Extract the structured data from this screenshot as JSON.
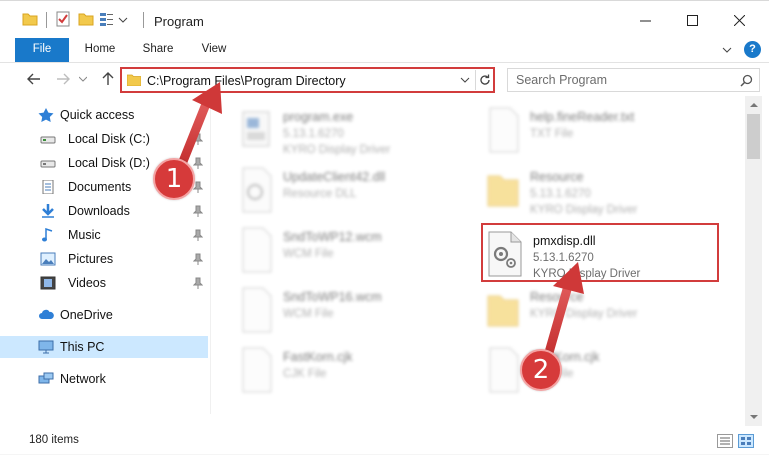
{
  "window": {
    "title": "Program",
    "controls": [
      "minimize-icon",
      "maximize-icon",
      "close-icon"
    ]
  },
  "ribbon": {
    "tabs": [
      {
        "label": "File"
      },
      {
        "label": "Home"
      },
      {
        "label": "Share"
      },
      {
        "label": "View"
      }
    ],
    "help_label": "?"
  },
  "address": {
    "path": "C:\\Program Files\\Program Directory",
    "search_placeholder": "Search Program"
  },
  "nav": {
    "quick_access": "Quick access",
    "pinned": [
      {
        "label": "Local Disk (C:)",
        "icon": "drive-icon"
      },
      {
        "label": "Local Disk (D:)",
        "icon": "drive-icon"
      },
      {
        "label": "Documents",
        "icon": "documents-icon"
      },
      {
        "label": "Downloads",
        "icon": "downloads-icon"
      },
      {
        "label": "Music",
        "icon": "music-icon"
      },
      {
        "label": "Pictures",
        "icon": "pictures-icon"
      },
      {
        "label": "Videos",
        "icon": "videos-icon"
      }
    ],
    "onedrive": "OneDrive",
    "this_pc": "This PC",
    "network": "Network"
  },
  "files": [
    {
      "name": "program.exe",
      "line2": "5.13.1.6270",
      "line3": "KYRO Display Driver",
      "icon": "exe-icon",
      "focused": false
    },
    {
      "name": "help.fineReader.txt",
      "line2": "TXT File",
      "line3": "",
      "icon": "text-file-icon",
      "focused": false
    },
    {
      "name": "UpdateClient42.dll",
      "line2": "Resource DLL",
      "line3": "",
      "icon": "dll-icon",
      "focused": false
    },
    {
      "name": "Resource",
      "line2": "5.13.1.6270",
      "line3": "KYRO Display Driver",
      "icon": "folder-icon",
      "focused": false
    },
    {
      "name": "SndToWP12.wcm",
      "line2": "WCM File",
      "line3": "",
      "icon": "generic-file-icon",
      "focused": false
    },
    {
      "name": "pmxdisp.dll",
      "line2": "5.13.1.6270",
      "line3": "KYRO Display Driver",
      "icon": "dll-icon",
      "focused": true
    },
    {
      "name": "SndToWP16.wcm",
      "line2": "WCM File",
      "line3": "",
      "icon": "generic-file-icon",
      "focused": false
    },
    {
      "name": "Resource",
      "line2": "KYRO Display Driver",
      "line3": "",
      "icon": "folder-icon",
      "focused": false
    },
    {
      "name": "FastKorn.cjk",
      "line2": "CJK File",
      "line3": "",
      "icon": "generic-file-icon",
      "focused": false
    },
    {
      "name": "FastKorn.cjk",
      "line2": "CJK File",
      "line3": "",
      "icon": "generic-file-icon",
      "focused": false
    }
  ],
  "status": {
    "item_count": "180 items"
  },
  "callouts": [
    {
      "label": "1"
    },
    {
      "label": "2"
    }
  ],
  "colors": {
    "accent": "#1979ca",
    "annotation_red": "#d23c3c",
    "selected_bg": "#cce8ff"
  }
}
